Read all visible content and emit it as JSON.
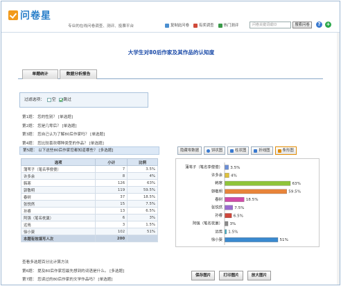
{
  "header": {
    "logo_text": "问卷星",
    "slogan": "专业的在线问卷调查、测评、投票平台",
    "links": [
      {
        "label": "复制此问卷",
        "icon": "copy-icon",
        "color": "#4a8fd0"
      },
      {
        "label": "有奖调查",
        "icon": "gift-icon",
        "color": "#d04a3a"
      },
      {
        "label": "热门测评",
        "icon": "doc-icon",
        "color": "#3a9a4a"
      }
    ],
    "search_placeholder": "问卷关键词或ID",
    "search_label": "搜索问卷",
    "help_icon": "?",
    "add_icon": "+"
  },
  "page_title": "大学生对80后作家及其作品的认知度",
  "tabs": [
    {
      "label": "单题统计"
    },
    {
      "label": "数据分析报告"
    }
  ],
  "filter": {
    "label": "过滤选项：",
    "opt_empty": "空",
    "opt_skip": "跳过"
  },
  "questions_top": [
    "第1题：  您的性别？  [单选题]",
    "第2题：  您是几零后？  [单选题]",
    "第3题：  您自己认为了解80后作家吗？  [单选题]",
    "第4题：  您比较喜欢哪种类型的作品？  [单选题]"
  ],
  "q5_title": "第5题：  以下这些80后作家您都知道哪些？  [多选题]",
  "table": {
    "headers": [
      "选项",
      "小计",
      "比例"
    ],
    "rows": [
      {
        "option": "蒲苇子（笔名李傻傻）",
        "count": "7",
        "pct": "3.5%"
      },
      {
        "option": "许多余",
        "count": "8",
        "pct": "4%"
      },
      {
        "option": "韩寒",
        "count": "126",
        "pct": "63%"
      },
      {
        "option": "郭敬明",
        "count": "119",
        "pct": "59.5%"
      },
      {
        "option": "春树",
        "count": "37",
        "pct": "18.5%"
      },
      {
        "option": "张悦然",
        "count": "15",
        "pct": "7.5%"
      },
      {
        "option": "孙睿",
        "count": "13",
        "pct": "6.5%"
      },
      {
        "option": "阿强（笔名枕巢）",
        "count": "6",
        "pct": "3%"
      },
      {
        "option": "远焉",
        "count": "3",
        "pct": "1.5%"
      },
      {
        "option": "徐小斐",
        "count": "102",
        "pct": "51%"
      }
    ],
    "total_label": "本题有效填写人次",
    "total_count": "200"
  },
  "questions_bottom": [
    "查看多选题百分比计算方法",
    "第6题：  提及80后作家您最先想到的词语是什么。  [多选题]",
    "第7题：  您读过的80后作家的文学作品吗？  [单选题]"
  ],
  "chart_tools": [
    {
      "label": "隐藏零数据",
      "icon": "",
      "color": ""
    },
    {
      "label": "饼状图",
      "icon": "pie-icon",
      "color": "#3a7ad0"
    },
    {
      "label": "柱状图",
      "icon": "bar-icon",
      "color": "#3a7ad0"
    },
    {
      "label": "折线图",
      "icon": "line-icon",
      "color": "#3a7ad0"
    },
    {
      "label": "条形图",
      "icon": "hbar-icon",
      "color": "#e08a00"
    }
  ],
  "chart_buttons": [
    "保存图片",
    "打印图片",
    "放大图片"
  ],
  "chart_data": {
    "type": "bar",
    "orientation": "horizontal",
    "categories": [
      "蒲苇子（笔名李傻傻）",
      "许多余",
      "韩寒",
      "郭敬明",
      "春树",
      "张悦然",
      "孙睿",
      "阿强（笔名枕巢）",
      "远焉",
      "徐小斐"
    ],
    "values": [
      3.5,
      4,
      63,
      59.5,
      18.5,
      7.5,
      6.5,
      3,
      1.5,
      51
    ],
    "labels": [
      "3.5%",
      "4%",
      "63%",
      "59.5%",
      "18.5%",
      "7.5%",
      "6.5%",
      "3%",
      "1.5%",
      "51%"
    ],
    "colors": [
      "#6b8fd8",
      "#e0c23a",
      "#8fc43a",
      "#e8843a",
      "#d04aa8",
      "#9a6bd0",
      "#d0463a",
      "#8a8a8a",
      "#3ab0c8",
      "#3a8ad0"
    ],
    "xlim": [
      0,
      100
    ],
    "grid": false
  }
}
